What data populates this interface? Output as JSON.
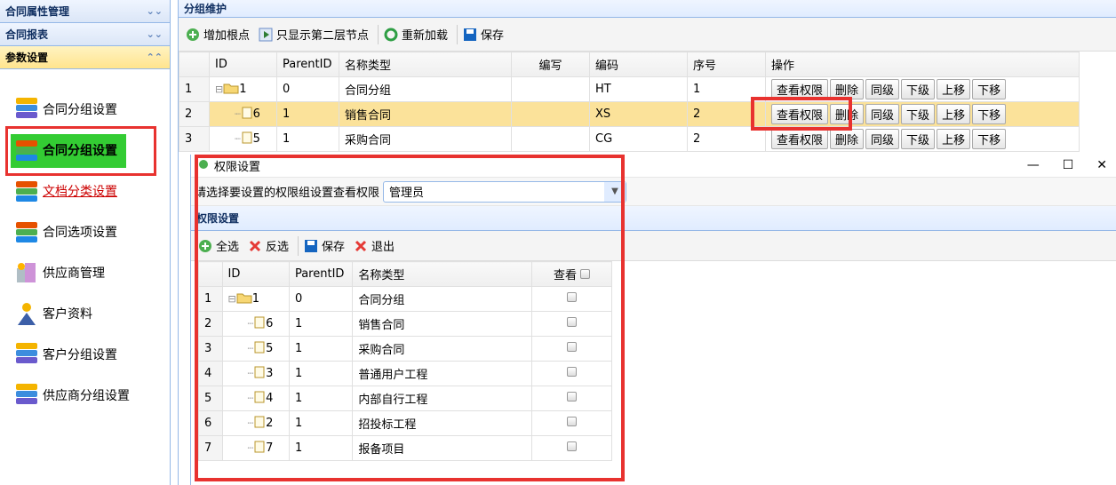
{
  "sidebar": {
    "sections": [
      {
        "title": "合同属性管理",
        "arrow": "⌄⌄"
      },
      {
        "title": "合同报表",
        "arrow": "⌄⌄"
      },
      {
        "title": "参数设置",
        "arrow": "⌃⌃"
      }
    ],
    "items": [
      {
        "label": "合同分组设置"
      },
      {
        "label": "合同分组设置"
      },
      {
        "label": "文档分类设置"
      },
      {
        "label": "合同选项设置"
      },
      {
        "label": "供应商管理"
      },
      {
        "label": "客户资料"
      },
      {
        "label": "客户分组设置"
      },
      {
        "label": "供应商分组设置"
      }
    ]
  },
  "main": {
    "title": "分组维护",
    "toolbar": {
      "add_root": "增加根点",
      "show_second": "只显示第二层节点",
      "reload": "重新加载",
      "save": "保存"
    },
    "columns": [
      "ID",
      "ParentID",
      "名称类型",
      "编写",
      "编码",
      "序号",
      "操作"
    ],
    "rows": [
      {
        "num": "1",
        "id": "1",
        "parent": "0",
        "name": "合同分组",
        "abbr": "",
        "code": "HT",
        "seq": "1"
      },
      {
        "num": "2",
        "id": "6",
        "parent": "1",
        "name": "销售合同",
        "abbr": "",
        "code": "XS",
        "seq": "2"
      },
      {
        "num": "3",
        "id": "5",
        "parent": "1",
        "name": "采购合同",
        "abbr": "",
        "code": "CG",
        "seq": "2"
      }
    ],
    "ops": {
      "view": "查看权限",
      "delete": "删除",
      "same": "同级",
      "down": "下级",
      "up": "上移",
      "move_down": "下移"
    }
  },
  "dialog": {
    "title": "权限设置",
    "prompt": "请选择要设置的权限组设置查看权限",
    "selected_group": "管理员",
    "section_title": "权限设置",
    "toolbar": {
      "select_all": "全选",
      "invert": "反选",
      "save": "保存",
      "exit": "退出"
    },
    "columns": [
      "ID",
      "ParentID",
      "名称类型",
      "查看"
    ],
    "rows": [
      {
        "num": "1",
        "id": "1",
        "parent": "0",
        "name": "合同分组"
      },
      {
        "num": "2",
        "id": "6",
        "parent": "1",
        "name": "销售合同"
      },
      {
        "num": "3",
        "id": "5",
        "parent": "1",
        "name": "采购合同"
      },
      {
        "num": "4",
        "id": "3",
        "parent": "1",
        "name": "普通用户工程"
      },
      {
        "num": "5",
        "id": "4",
        "parent": "1",
        "name": "内部自行工程"
      },
      {
        "num": "6",
        "id": "2",
        "parent": "1",
        "name": "招投标工程"
      },
      {
        "num": "7",
        "id": "7",
        "parent": "1",
        "name": "报备项目"
      }
    ]
  },
  "colors": {
    "accent_red": "#e8322f",
    "selected_row": "#fbe29a",
    "header_blue": "#0e2d5f",
    "menu_highlight": "#33cc33"
  }
}
